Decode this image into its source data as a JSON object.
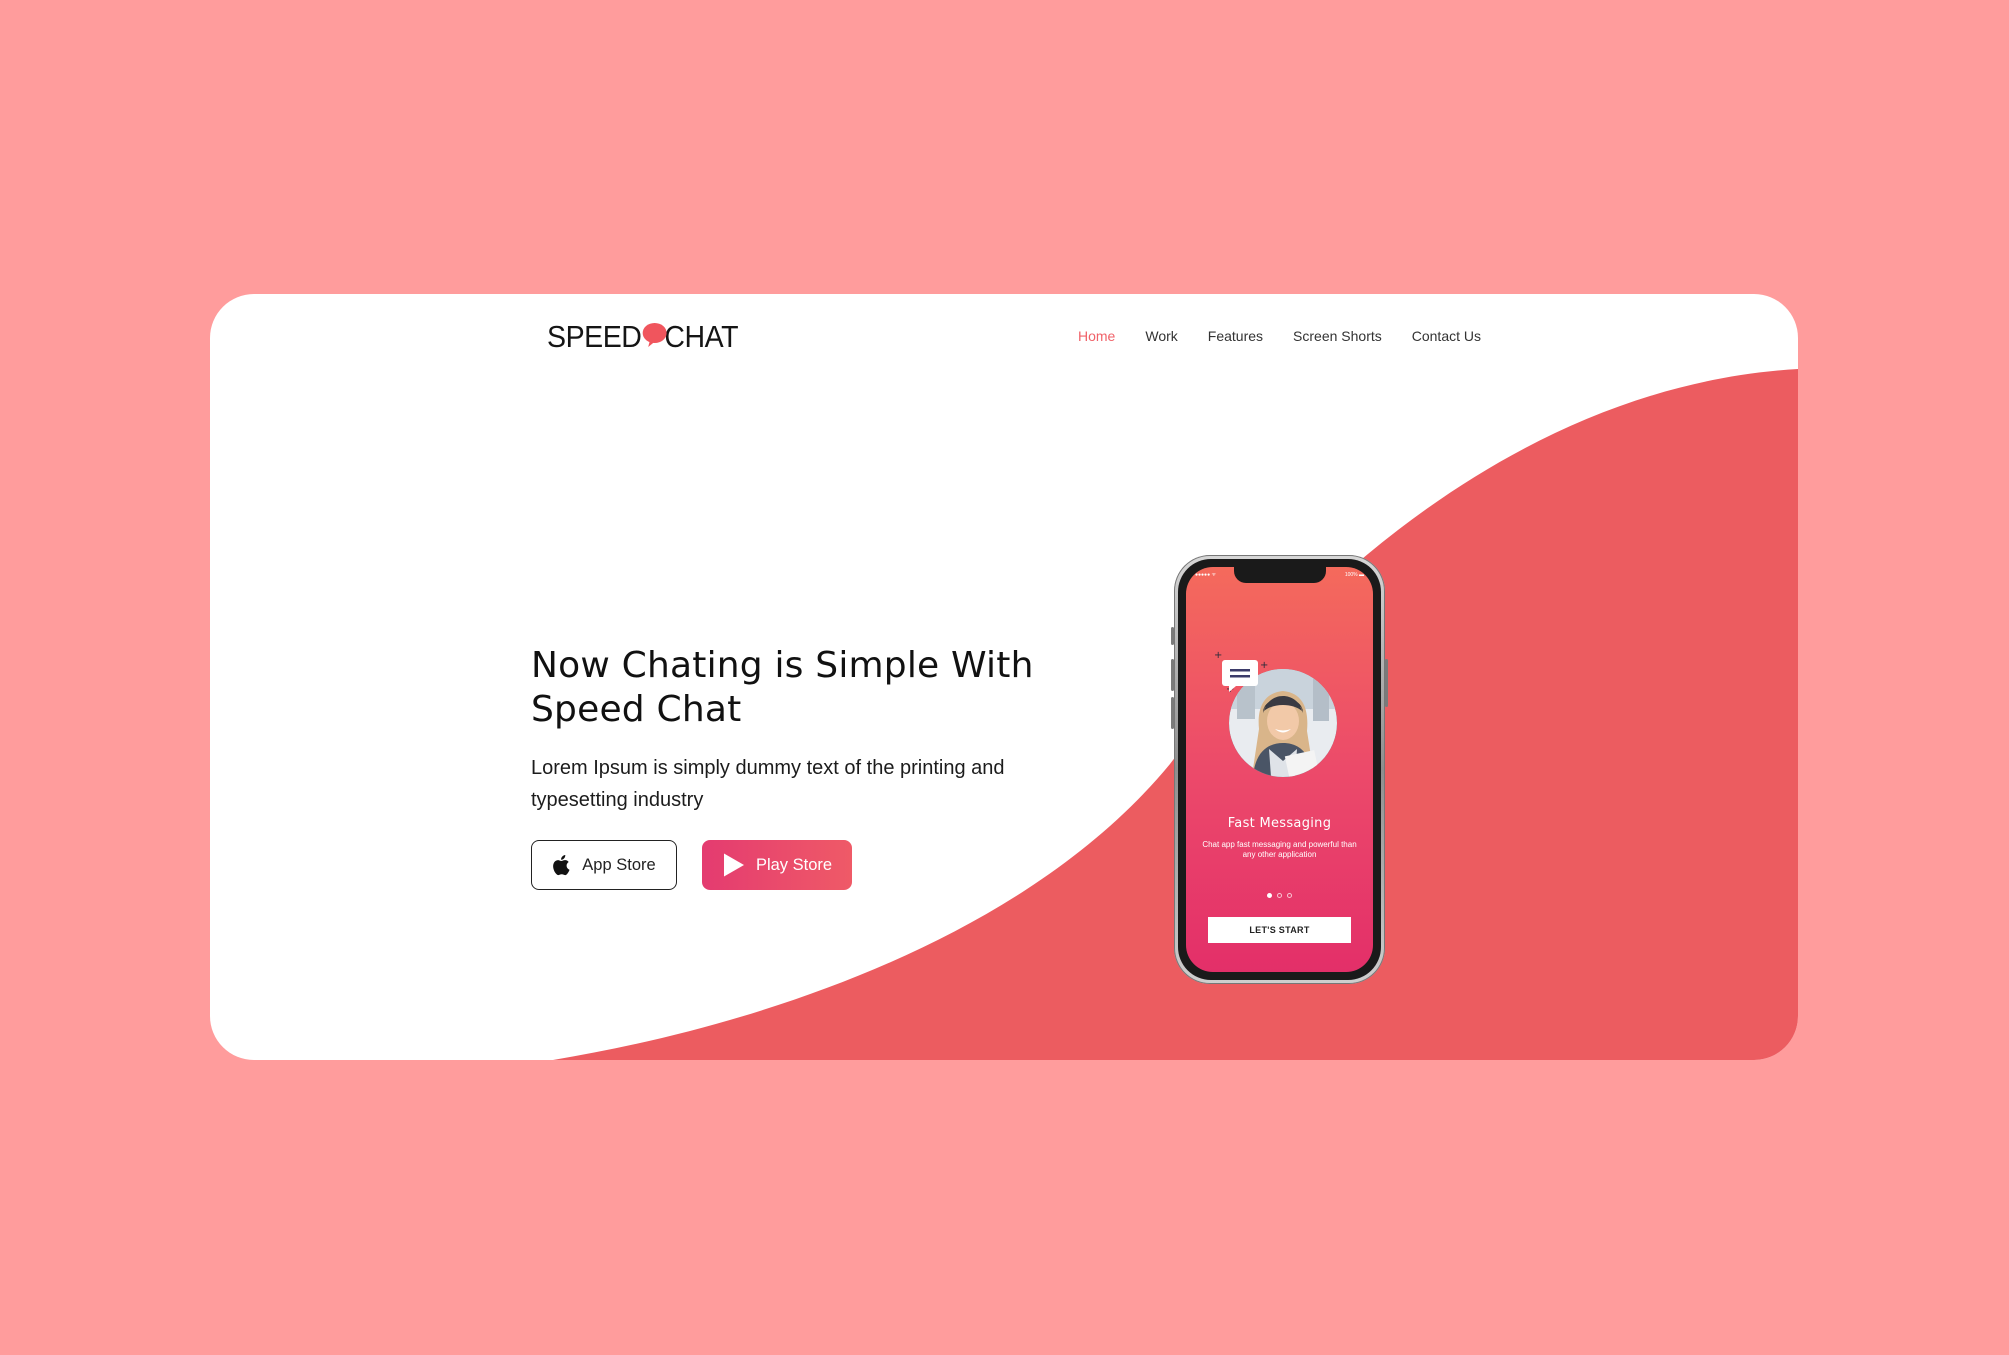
{
  "colors": {
    "background": "#ff9c9c",
    "accent": "#f06269",
    "wave": "#ec5c60",
    "card": "#ffffff"
  },
  "header": {
    "logo_left": "SPEED",
    "logo_right": "CHAT",
    "logo_icon": "speech-bubble-icon",
    "nav": [
      {
        "label": "Home",
        "active": true
      },
      {
        "label": "Work",
        "active": false
      },
      {
        "label": "Features",
        "active": false
      },
      {
        "label": "Screen Shorts",
        "active": false
      },
      {
        "label": "Contact Us",
        "active": false
      }
    ]
  },
  "hero": {
    "title_line1": "Now Chating is Simple With",
    "title_line2": "Speed Chat",
    "subtitle": "Lorem Ipsum is simply dummy text of the printing and typesetting industry",
    "app_store_label": "App Store",
    "app_store_icon": "apple-icon",
    "play_store_label": "Play Store",
    "play_store_icon": "play-icon"
  },
  "phone": {
    "status_left": "●●●●● ᯤ",
    "status_right": "100% ▬",
    "screen_title": "Fast Messaging",
    "screen_desc": "Chat app fast messaging and powerful than any other application",
    "pager_count": 3,
    "pager_active": 0,
    "cta_label": "LET'S START"
  }
}
